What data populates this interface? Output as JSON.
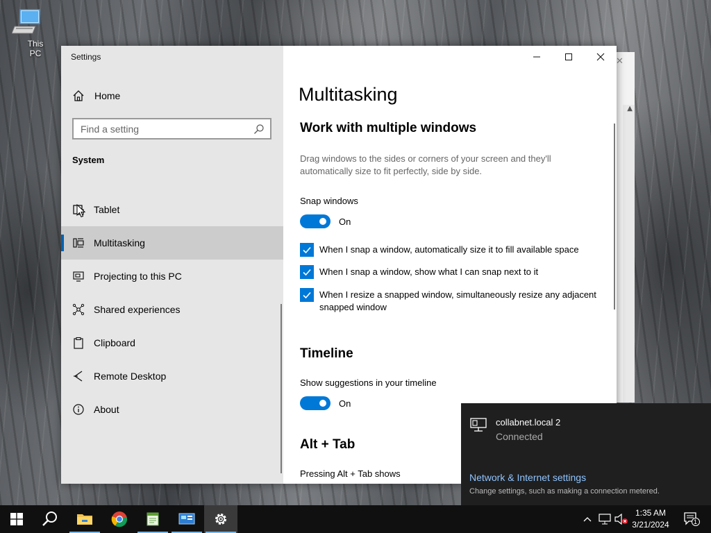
{
  "desktop": {
    "icons": [
      {
        "label": "This PC",
        "icon": "this-pc-icon"
      }
    ]
  },
  "window": {
    "title": "Settings",
    "controls": {
      "minimize": "minimize-icon",
      "maximize": "maximize-icon",
      "close": "close-icon"
    }
  },
  "sidebar": {
    "home_label": "Home",
    "search_placeholder": "Find a setting",
    "section": "System",
    "items": [
      {
        "label": "Tablet",
        "icon": "tablet-icon"
      },
      {
        "label": "Multitasking",
        "icon": "multitasking-icon",
        "active": true
      },
      {
        "label": "Projecting to this PC",
        "icon": "projecting-icon"
      },
      {
        "label": "Shared experiences",
        "icon": "shared-experiences-icon"
      },
      {
        "label": "Clipboard",
        "icon": "clipboard-icon"
      },
      {
        "label": "Remote Desktop",
        "icon": "remote-desktop-icon"
      },
      {
        "label": "About",
        "icon": "info-icon"
      }
    ]
  },
  "content": {
    "title": "Multitasking",
    "windows_section": {
      "heading": "Work with multiple windows",
      "description": "Drag windows to the sides or corners of your screen and they'll automatically size to fit perfectly, side by side.",
      "snap_label": "Snap windows",
      "snap_state": "On",
      "checks": [
        "When I snap a window, automatically size it to fill available space",
        "When I snap a window, show what I can snap next to it",
        "When I resize a snapped window, simultaneously resize any adjacent snapped window"
      ]
    },
    "timeline_section": {
      "heading": "Timeline",
      "suggest_label": "Show suggestions in your timeline",
      "suggest_state": "On"
    },
    "alttab_section": {
      "heading": "Alt + Tab",
      "label": "Pressing Alt + Tab shows"
    }
  },
  "network_flyout": {
    "network_name": "collabnet.local 2",
    "status": "Connected",
    "settings_link": "Network & Internet settings",
    "settings_sub": "Change settings, such as making a connection metered."
  },
  "taskbar": {
    "apps": [
      "start",
      "search",
      "file-explorer",
      "chrome",
      "notepad",
      "control-panel",
      "settings"
    ],
    "clock_time": "1:35 AM",
    "clock_date": "3/21/2024",
    "notification_count": "1"
  },
  "colors": {
    "accent": "#0078d7",
    "link": "#8fc4ff",
    "sidebar_bg": "#e6e6e6"
  }
}
